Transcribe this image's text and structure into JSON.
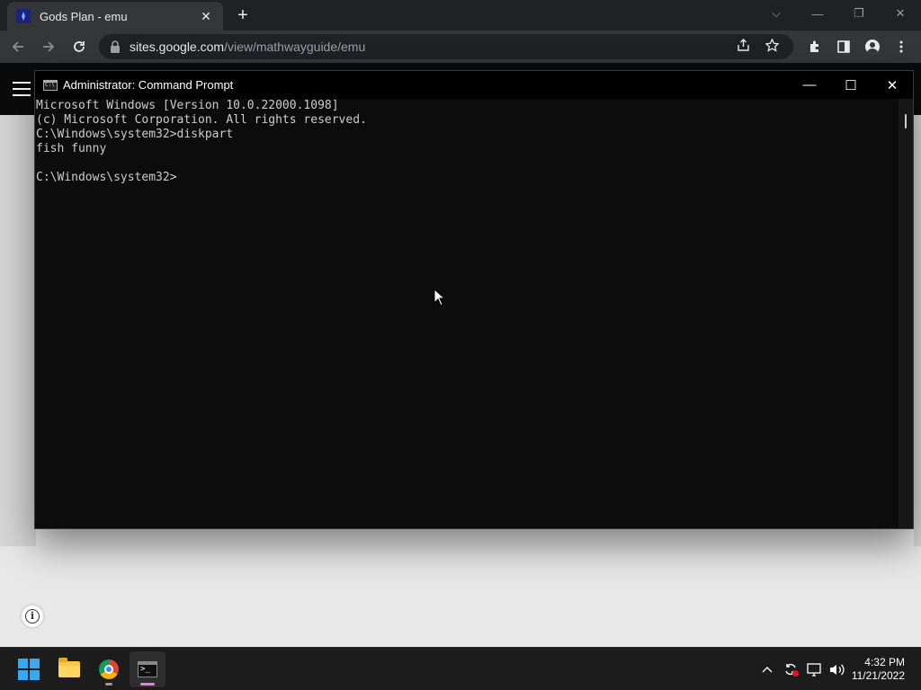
{
  "browser": {
    "tab_title": "Gods Plan - emu",
    "tab_close": "✕",
    "new_tab": "+",
    "window_controls": {
      "dropdown": "⌵",
      "minimize": "—",
      "restore": "❐",
      "close": "✕"
    },
    "url_domain": "sites.google.com",
    "url_path": "/view/mathwayguide/emu"
  },
  "cmd": {
    "title": "Administrator: Command Prompt",
    "controls": {
      "minimize": "—",
      "maximize": "☐",
      "close": "✕"
    },
    "lines": [
      "Microsoft Windows [Version 10.0.22000.1098]",
      "(c) Microsoft Corporation. All rights reserved.",
      "C:\\Windows\\system32>diskpart",
      "fish funny",
      "",
      "C:\\Windows\\system32>"
    ]
  },
  "page": {
    "info_label": "i"
  },
  "taskbar": {
    "time": "4:32 PM",
    "date": "11/21/2022"
  },
  "colors": {
    "accent_windows": "#3aa7f0",
    "terminal_bg": "#0c0c0c",
    "terminal_text": "#cccccc"
  }
}
